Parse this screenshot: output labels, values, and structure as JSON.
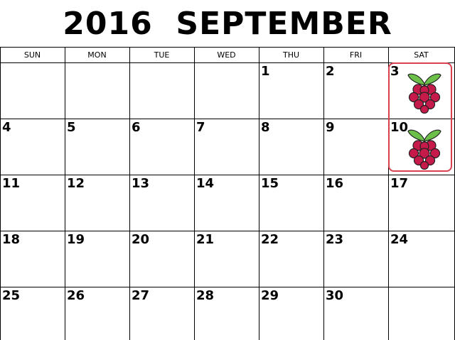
{
  "title": {
    "year": "2016",
    "month": "SEPTEMBER"
  },
  "weekdays": [
    "SUN",
    "MON",
    "TUE",
    "WED",
    "THU",
    "FRI",
    "SAT"
  ],
  "weeks": [
    [
      "",
      "",
      "",
      "",
      "1",
      "2",
      "3"
    ],
    [
      "4",
      "5",
      "6",
      "7",
      "8",
      "9",
      "10"
    ],
    [
      "11",
      "12",
      "13",
      "14",
      "15",
      "16",
      "17"
    ],
    [
      "18",
      "19",
      "20",
      "21",
      "22",
      "23",
      "24"
    ],
    [
      "25",
      "26",
      "27",
      "28",
      "29",
      "30",
      ""
    ]
  ],
  "marked_days": [
    "3",
    "10"
  ],
  "icons": {
    "marker": "raspberry-icon"
  },
  "colors": {
    "highlight_border": "#d94050",
    "berry": "#c51a4a",
    "leaf": "#6cc04a"
  }
}
